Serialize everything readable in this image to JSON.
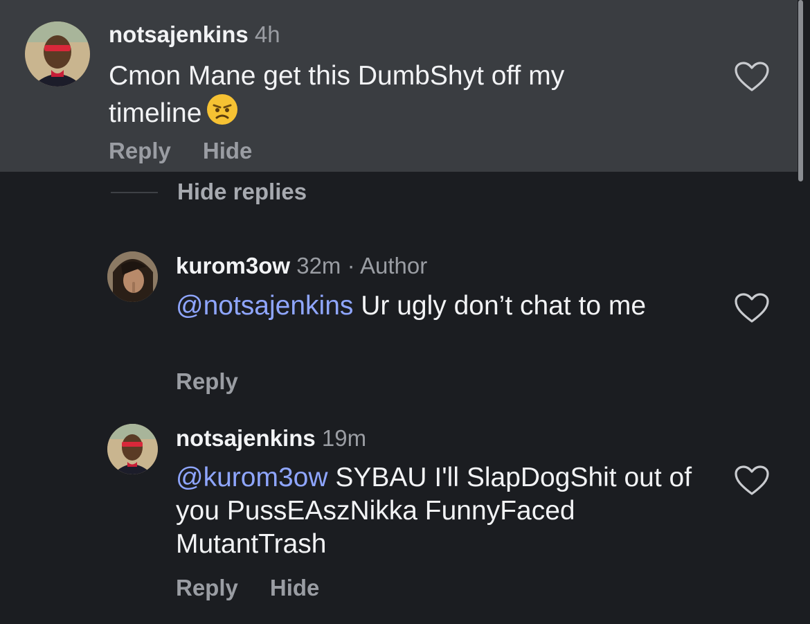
{
  "comments": [
    {
      "username": "notsajenkins",
      "time": "4h",
      "text": "Cmon Mane get this DumbShyt off my timeline",
      "emoji": "angry-face-emoji",
      "actions": {
        "reply": "Reply",
        "hide": "Hide"
      },
      "highlighted": true
    }
  ],
  "hide_replies_label": "Hide replies",
  "replies": [
    {
      "username": "kurom3ow",
      "time": "32m",
      "separator": "·",
      "badge": "Author",
      "mention": "@notsajenkins",
      "text": "Ur ugly don’t chat to me",
      "actions": {
        "reply": "Reply"
      }
    },
    {
      "username": "notsajenkins",
      "time": "19m",
      "mention": "@kurom3ow",
      "text": "SYBAU I'll SlapDogShit out of you PussEAszNikka FunnyFaced MutantTrash",
      "actions": {
        "reply": "Reply",
        "hide": "Hide"
      }
    }
  ],
  "colors": {
    "background": "#1b1d21",
    "highlight": "#3a3d41",
    "mention": "#8fa6ff",
    "muted_text": "#9a9da3"
  },
  "icons": [
    "heart-icon",
    "avatar",
    "angry-face-emoji"
  ]
}
